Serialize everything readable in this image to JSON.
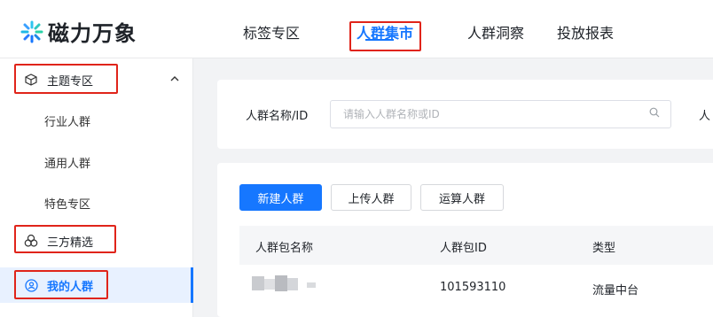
{
  "brand": {
    "name": "磁力万象"
  },
  "nav": {
    "items": [
      {
        "label": "标签专区"
      },
      {
        "label": "人群集市"
      },
      {
        "label": "人群洞察"
      },
      {
        "label": "投放报表"
      }
    ],
    "active_index": 1
  },
  "sidebar": {
    "groups": [
      {
        "label": "主题专区",
        "icon": "cube-icon",
        "expanded": true
      },
      {
        "label": "三方精选",
        "icon": "three-circles-icon"
      },
      {
        "label": "我的人群",
        "icon": "user-circle-icon",
        "active": true
      }
    ],
    "sub_items": [
      {
        "label": "行业人群"
      },
      {
        "label": "通用人群"
      },
      {
        "label": "特色专区"
      }
    ]
  },
  "filter": {
    "name_label": "人群名称/ID",
    "input_placeholder": "请输入人群名称或ID",
    "truncated_label": "人"
  },
  "actions": {
    "create": "新建人群",
    "upload": "上传人群",
    "compute": "运算人群"
  },
  "table": {
    "columns": [
      "人群包名称",
      "人群包ID",
      "类型"
    ],
    "rows": [
      {
        "name_blurred": true,
        "id": "101593110",
        "type": "流量中台"
      }
    ]
  },
  "colors": {
    "accent": "#1677ff",
    "highlight_box": "#e0241a",
    "active_bg": "#e8f1ff"
  }
}
